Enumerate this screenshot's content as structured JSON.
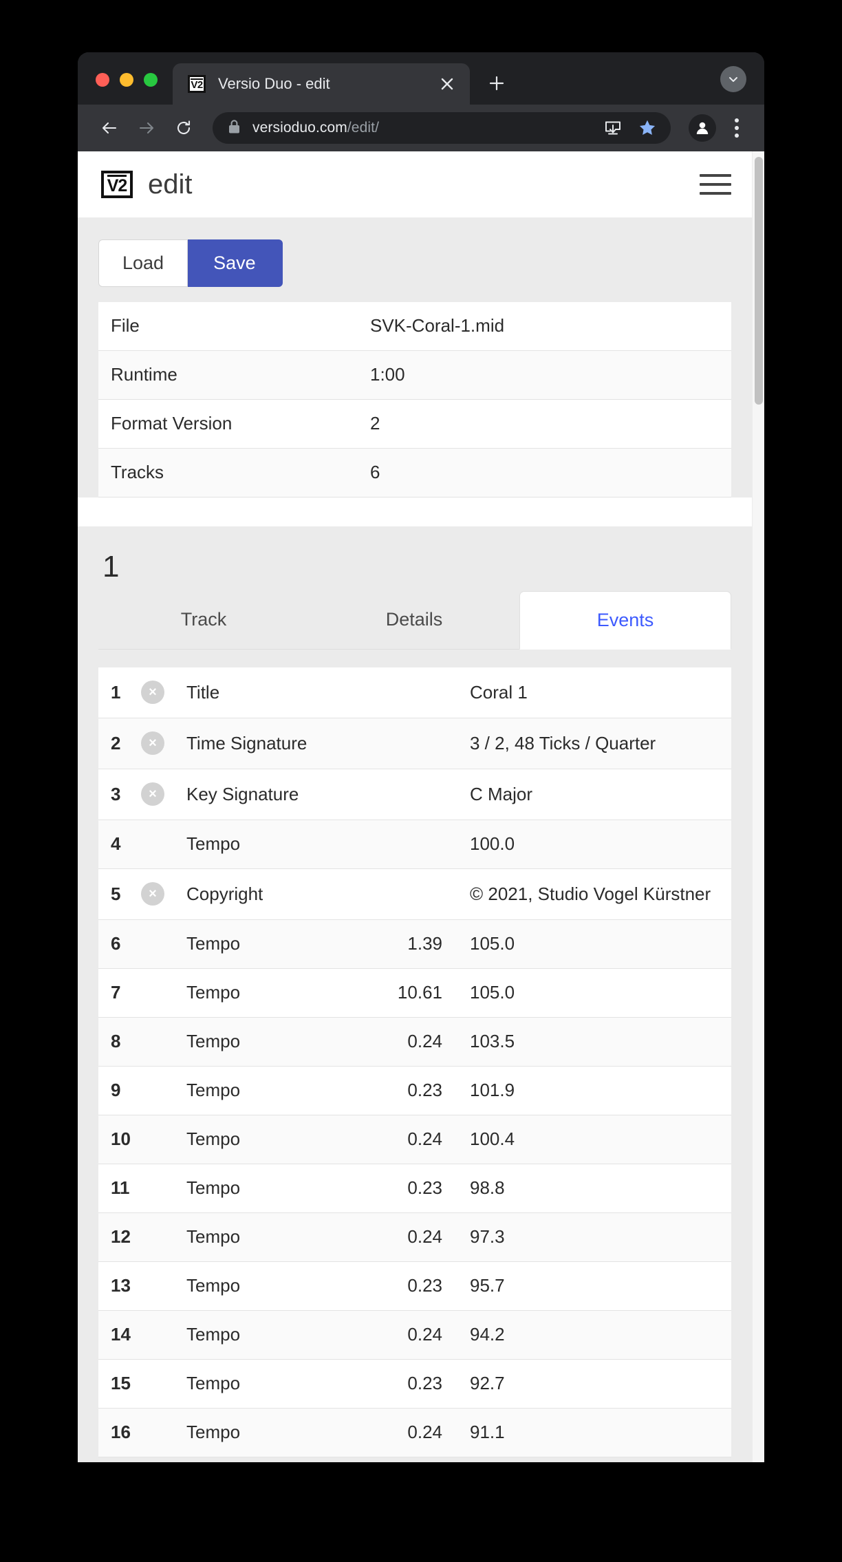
{
  "browser": {
    "tab": {
      "title": "Versio Duo - edit",
      "favicon_text": "V2",
      "close_icon": "close-icon"
    },
    "new_tab_label": "+",
    "tabstrip_menu_icon": "chevron-down-icon",
    "nav": {
      "back_icon": "back-arrow-icon",
      "forward_icon": "forward-arrow-icon",
      "reload_icon": "reload-icon"
    },
    "omnibox": {
      "lock_icon": "lock-icon",
      "url_domain": "versioduo.com",
      "url_path": "/edit/",
      "install_icon": "install-download-icon",
      "bookmark_icon": "star-icon",
      "bookmark_color": "#8ab4f8"
    },
    "profile_icon": "profile-avatar-icon",
    "menu_icon": "kebab-menu-icon"
  },
  "app": {
    "logo_text": "V2",
    "title": "edit",
    "menu_icon": "hamburger-menu-icon",
    "actions": {
      "load_label": "Load",
      "save_label": "Save",
      "save_color": "#4355b9"
    },
    "file_info": [
      {
        "label": "File",
        "value": "SVK-Coral-1.mid"
      },
      {
        "label": "Runtime",
        "value": "1:00"
      },
      {
        "label": "Format Version",
        "value": "2"
      },
      {
        "label": "Tracks",
        "value": "6"
      }
    ],
    "track": {
      "number": "1",
      "tabs": [
        {
          "label": "Track",
          "active": false
        },
        {
          "label": "Details",
          "active": false
        },
        {
          "label": "Events",
          "active": true
        }
      ],
      "active_tab_color": "#3d5afe"
    },
    "events": [
      {
        "index": "1",
        "deletable": true,
        "name": "Title",
        "time": "",
        "value": "Coral 1"
      },
      {
        "index": "2",
        "deletable": true,
        "name": "Time Signature",
        "time": "",
        "value": "3 / 2, 48 Ticks / Quarter"
      },
      {
        "index": "3",
        "deletable": true,
        "name": "Key Signature",
        "time": "",
        "value": "C Major"
      },
      {
        "index": "4",
        "deletable": false,
        "name": "Tempo",
        "time": "",
        "value": "100.0"
      },
      {
        "index": "5",
        "deletable": true,
        "name": "Copyright",
        "time": "",
        "value": "© 2021, Studio Vogel Kürstner"
      },
      {
        "index": "6",
        "deletable": false,
        "name": "Tempo",
        "time": "1.39",
        "value": "105.0"
      },
      {
        "index": "7",
        "deletable": false,
        "name": "Tempo",
        "time": "10.61",
        "value": "105.0"
      },
      {
        "index": "8",
        "deletable": false,
        "name": "Tempo",
        "time": "0.24",
        "value": "103.5"
      },
      {
        "index": "9",
        "deletable": false,
        "name": "Tempo",
        "time": "0.23",
        "value": "101.9"
      },
      {
        "index": "10",
        "deletable": false,
        "name": "Tempo",
        "time": "0.24",
        "value": "100.4"
      },
      {
        "index": "11",
        "deletable": false,
        "name": "Tempo",
        "time": "0.23",
        "value": "98.8"
      },
      {
        "index": "12",
        "deletable": false,
        "name": "Tempo",
        "time": "0.24",
        "value": "97.3"
      },
      {
        "index": "13",
        "deletable": false,
        "name": "Tempo",
        "time": "0.23",
        "value": "95.7"
      },
      {
        "index": "14",
        "deletable": false,
        "name": "Tempo",
        "time": "0.24",
        "value": "94.2"
      },
      {
        "index": "15",
        "deletable": false,
        "name": "Tempo",
        "time": "0.23",
        "value": "92.7"
      },
      {
        "index": "16",
        "deletable": false,
        "name": "Tempo",
        "time": "0.24",
        "value": "91.1"
      }
    ],
    "delete_icon": "delete-x-icon"
  }
}
